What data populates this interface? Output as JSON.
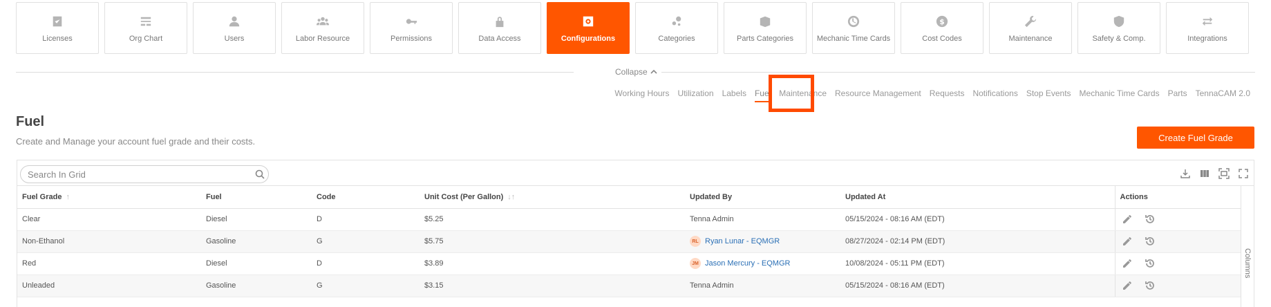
{
  "nav": {
    "tiles": [
      {
        "label": "Licenses",
        "icon": "license-check-icon"
      },
      {
        "label": "Org Chart",
        "icon": "org-chart-icon"
      },
      {
        "label": "Users",
        "icon": "user-icon"
      },
      {
        "label": "Labor Resource",
        "icon": "group-icon"
      },
      {
        "label": "Permissions",
        "icon": "key-icon"
      },
      {
        "label": "Data Access",
        "icon": "lock-icon"
      },
      {
        "label": "Configurations",
        "icon": "gear-box-icon",
        "active": true
      },
      {
        "label": "Categories",
        "icon": "categories-icon"
      },
      {
        "label": "Parts Categories",
        "icon": "parts-box-icon"
      },
      {
        "label": "Mechanic Time Cards",
        "icon": "clock-icon"
      },
      {
        "label": "Cost Codes",
        "icon": "dollar-icon"
      },
      {
        "label": "Maintenance",
        "icon": "wrench-icon"
      },
      {
        "label": "Safety & Comp.",
        "icon": "shield-icon"
      },
      {
        "label": "Integrations",
        "icon": "swap-arrows-icon"
      }
    ],
    "collapse_label": "Collapse"
  },
  "subtabs": [
    "Working Hours",
    "Utilization",
    "Labels",
    "Fuel",
    "Maintenance",
    "Resource Management",
    "Requests",
    "Notifications",
    "Stop Events",
    "Mechanic Time Cards",
    "Parts",
    "TennaCAM 2.0"
  ],
  "active_subtab": "Fuel",
  "page": {
    "title": "Fuel",
    "subtitle": "Create and Manage your account fuel grade and their costs.",
    "create_button": "Create Fuel Grade"
  },
  "grid": {
    "search_placeholder": "Search In Grid",
    "columns_label": "Columns",
    "headers": [
      "Fuel Grade",
      "Fuel",
      "Code",
      "Unit Cost (Per Gallon)",
      "Updated By",
      "Updated At",
      "Actions"
    ],
    "rows": [
      {
        "grade": "Clear",
        "fuel": "Diesel",
        "code": "D",
        "cost": "$5.25",
        "updated_by": "Tenna Admin",
        "initials": "",
        "updated_at": "05/15/2024 - 08:16 AM (EDT)"
      },
      {
        "grade": "Non-Ethanol",
        "fuel": "Gasoline",
        "code": "G",
        "cost": "$5.75",
        "updated_by": "Ryan Lunar - EQMGR",
        "initials": "RL",
        "updated_at": "08/27/2024 - 02:14 PM (EDT)"
      },
      {
        "grade": "Red",
        "fuel": "Diesel",
        "code": "D",
        "cost": "$3.89",
        "updated_by": "Jason Mercury - EQMGR",
        "initials": "JM",
        "updated_at": "10/08/2024 - 05:11 PM (EDT)"
      },
      {
        "grade": "Unleaded",
        "fuel": "Gasoline",
        "code": "G",
        "cost": "$3.15",
        "updated_by": "Tenna Admin",
        "initials": "",
        "updated_at": "05/15/2024 - 08:16 AM (EDT)"
      }
    ]
  },
  "colors": {
    "accent": "#ff5600",
    "link": "#2a6fb5",
    "highlight": "#ff4a00"
  }
}
